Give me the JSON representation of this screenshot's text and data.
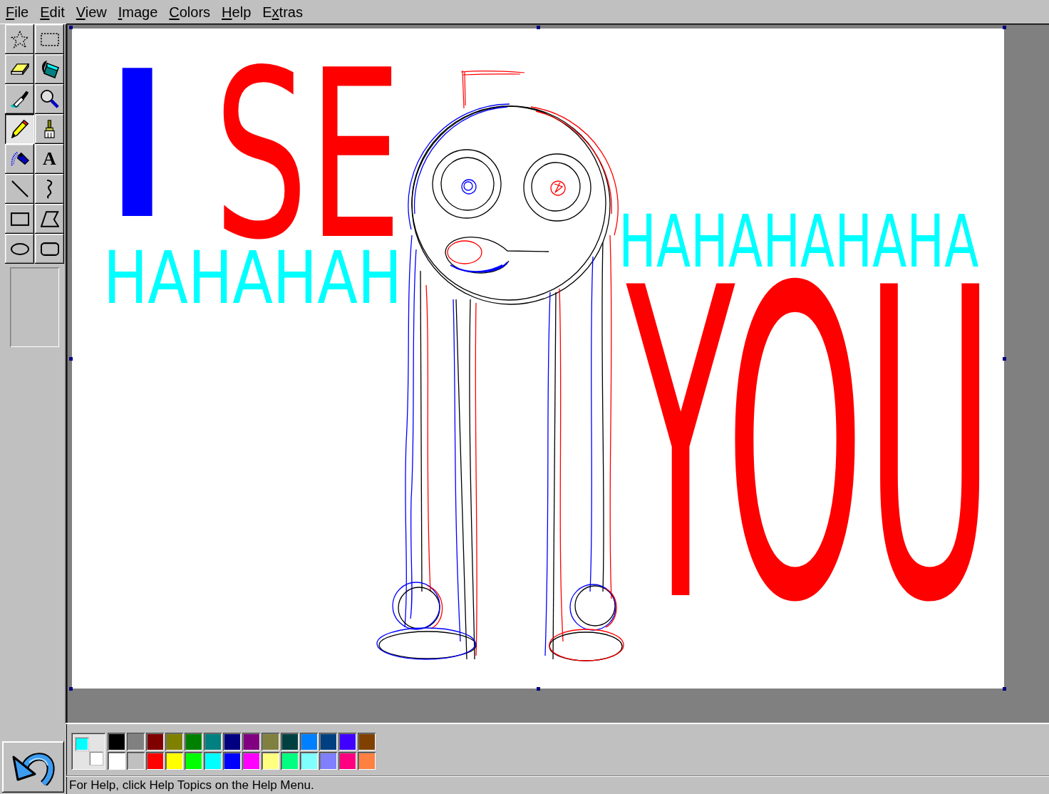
{
  "menu": [
    {
      "access_key": "F",
      "label_end": "ile"
    },
    {
      "access_key": "E",
      "label_end": "dit"
    },
    {
      "access_key": "V",
      "label_end": "iew"
    },
    {
      "access_key": "I",
      "label_end": "mage"
    },
    {
      "access_key": "C",
      "label_end": "olors"
    },
    {
      "access_key": "H",
      "label_end": "elp"
    },
    {
      "label_start": "E",
      "access_key": "x",
      "label_end": "tras"
    }
  ],
  "tools": [
    {
      "kind": "free-form-select",
      "selected": false
    },
    {
      "kind": "select",
      "selected": false
    },
    {
      "kind": "eraser",
      "selected": false
    },
    {
      "kind": "fill",
      "selected": false
    },
    {
      "kind": "pick-color",
      "selected": false
    },
    {
      "kind": "magnifier",
      "selected": false
    },
    {
      "kind": "pencil",
      "selected": true
    },
    {
      "kind": "brush",
      "selected": false
    },
    {
      "kind": "airbrush",
      "selected": false
    },
    {
      "kind": "text",
      "glyph": "A",
      "selected": false
    },
    {
      "kind": "line",
      "selected": false
    },
    {
      "kind": "curve",
      "selected": false
    },
    {
      "kind": "rectangle",
      "selected": false
    },
    {
      "kind": "polygon",
      "selected": false
    },
    {
      "kind": "ellipse",
      "selected": false
    },
    {
      "kind": "rounded-rectangle",
      "selected": false
    }
  ],
  "canvas": {
    "scribbles": [
      {
        "text": "I",
        "color": "#0000ff"
      },
      {
        "text": "SE",
        "color": "#ff0000"
      },
      {
        "text": "HAHAHAH",
        "color": "#00ffff"
      },
      {
        "text": "HAHAHAHAHA",
        "color": "#00ffff"
      },
      {
        "text": "YOU",
        "color": "#ff0000"
      }
    ]
  },
  "palette": {
    "foreground": {
      "color": "#00ffff"
    },
    "background": {
      "color": "#ffffff"
    },
    "swatches": [
      {
        "color": "#000000"
      },
      {
        "color": "#808080"
      },
      {
        "color": "#800000"
      },
      {
        "color": "#808000"
      },
      {
        "color": "#008000"
      },
      {
        "color": "#008080"
      },
      {
        "color": "#000080"
      },
      {
        "color": "#800080"
      },
      {
        "color": "#808040"
      },
      {
        "color": "#004040"
      },
      {
        "color": "#0080ff"
      },
      {
        "color": "#004080"
      },
      {
        "color": "#4000ff"
      },
      {
        "color": "#804000"
      },
      {
        "color": "#ffffff"
      },
      {
        "color": "#c0c0c0"
      },
      {
        "color": "#ff0000"
      },
      {
        "color": "#ffff00"
      },
      {
        "color": "#00ff00"
      },
      {
        "color": "#00ffff"
      },
      {
        "color": "#0000ff"
      },
      {
        "color": "#ff00ff"
      },
      {
        "color": "#ffff80"
      },
      {
        "color": "#00ff80"
      },
      {
        "color": "#80ffff"
      },
      {
        "color": "#8080ff"
      },
      {
        "color": "#ff0080"
      },
      {
        "color": "#ff8040"
      }
    ]
  },
  "status_bar": {
    "text": "For Help, click Help Topics on the Help Menu."
  }
}
